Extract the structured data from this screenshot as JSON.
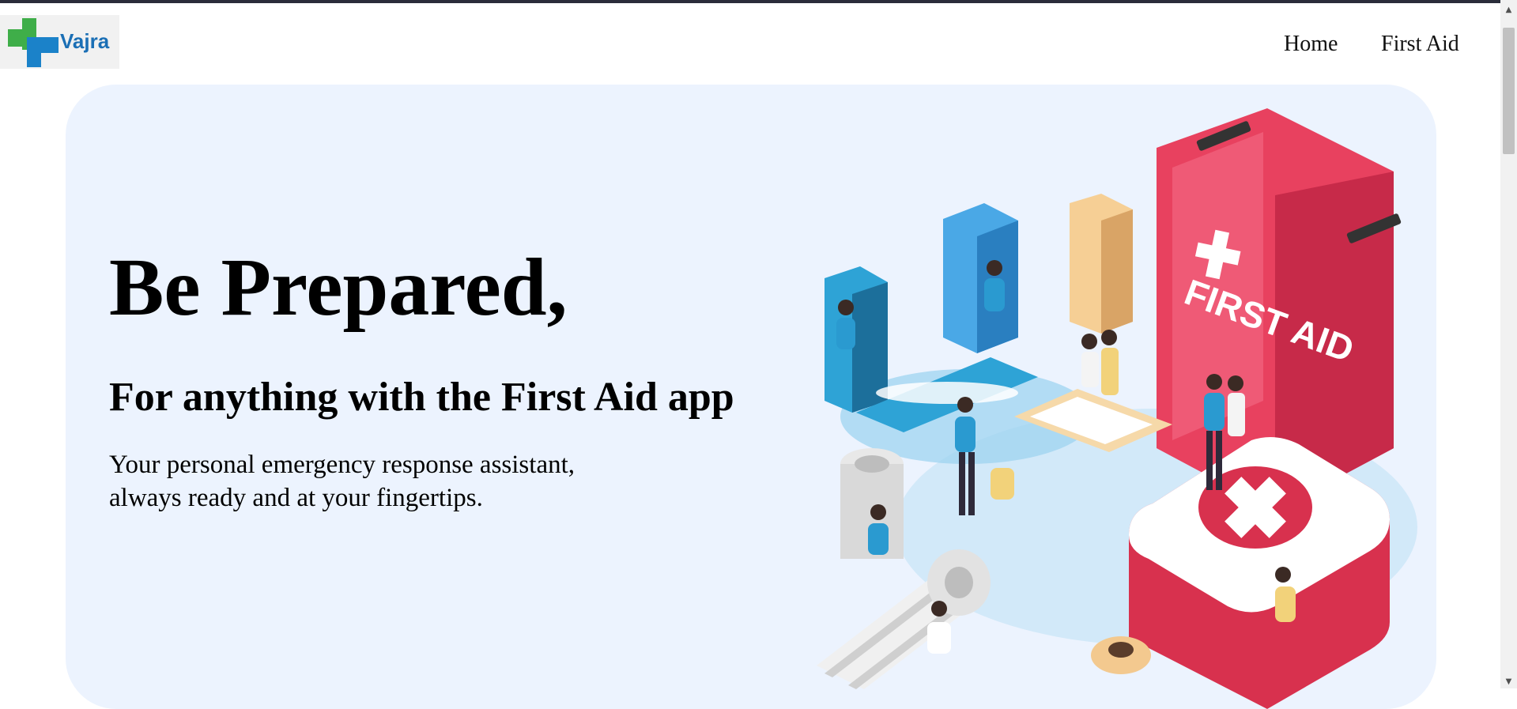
{
  "brand": {
    "name": "Vajra",
    "icon": "medical-cross-logo-icon"
  },
  "nav": {
    "home": "Home",
    "first_aid": "First Aid"
  },
  "hero": {
    "title": "Be Prepared,",
    "subtitle": "For anything with the First Aid app",
    "description": "Your personal emergency response assistant, always ready and at your fingertips."
  },
  "illustration": {
    "kit_label": "FIRST AID"
  },
  "scrollbar": {
    "up": "▲",
    "down": "▼"
  },
  "colors": {
    "hero_bg": "#ecf3fe",
    "brand_blue": "#1b6fb5",
    "brand_green": "#3fae49",
    "kit_red": "#e8415f"
  }
}
